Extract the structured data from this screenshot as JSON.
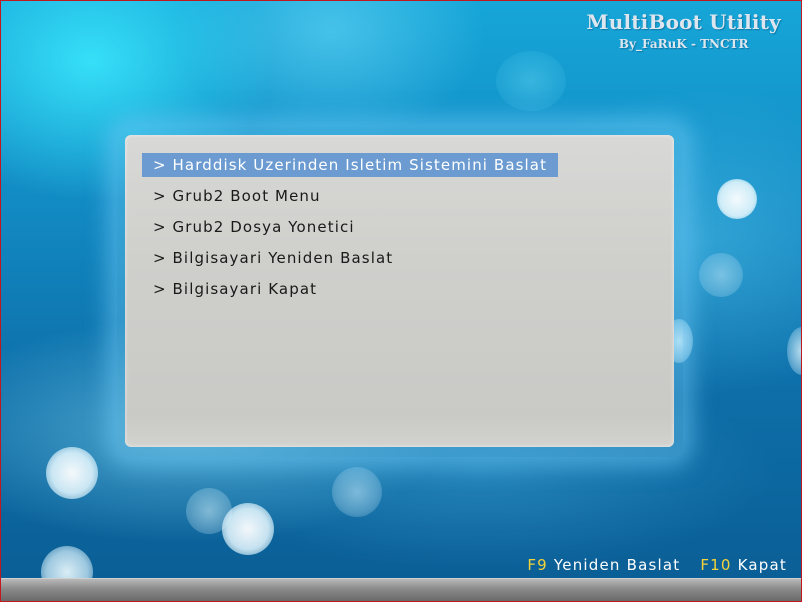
{
  "branding": {
    "title": "MultiBoot Utility",
    "subtitle": "By_FaRuK - TNCTR"
  },
  "menu": {
    "selected_index": 0,
    "selected_color": "#6b9bd0",
    "items": [
      {
        "label": "> Harddisk Uzerinden Isletim Sistemini Baslat"
      },
      {
        "label": "> Grub2 Boot Menu"
      },
      {
        "label": "> Grub2 Dosya Yonetici"
      },
      {
        "label": "> Bilgisayari Yeniden Baslat"
      },
      {
        "label": "> Bilgisayari Kapat"
      }
    ]
  },
  "hotkeys": [
    {
      "key": "F9",
      "label": "Yeniden Baslat"
    },
    {
      "key": "F10",
      "label": "Kapat"
    }
  ],
  "colors": {
    "hotkey_key": "#f2d33a",
    "hotkey_label": "#ffffff",
    "frame_border": "#c0181c"
  }
}
